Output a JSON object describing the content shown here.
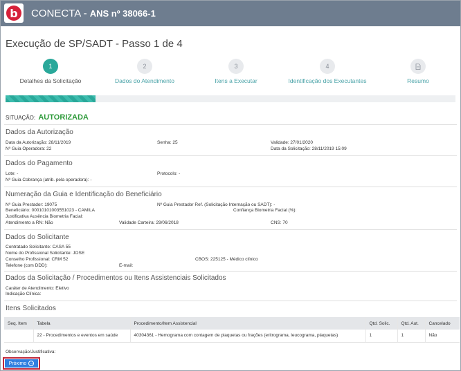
{
  "header": {
    "brand": "CONECTA",
    "ans": "ANS nº 38066-1",
    "logo_letter": "b"
  },
  "page_title": "Execução de SP/SADT - Passo 1 de 4",
  "steps": [
    {
      "num": "1",
      "label": "Detalhes da Solicitação",
      "icon": ""
    },
    {
      "num": "2",
      "label": "Dados do Atendimento",
      "icon": ""
    },
    {
      "num": "3",
      "label": "Itens a Executar",
      "icon": ""
    },
    {
      "num": "4",
      "label": "Identificação dos Executantes",
      "icon": ""
    },
    {
      "num": "",
      "label": "Resumo",
      "icon": "document-icon"
    }
  ],
  "progress": {
    "fraction": 0.2
  },
  "situacao": {
    "label": "SITUAÇÃO:",
    "value": "AUTORIZADA"
  },
  "sections": {
    "autorizacao": "Dados da Autorização",
    "pagamento": "Dados do Pagamento",
    "beneficiario": "Numeração da Guia e Identificação do Beneficiário",
    "solicitante": "Dados do Solicitante",
    "solicitacao": "Dados da Solicitação / Procedimentos ou Itens Assistenciais Solicitados",
    "itens": "Itens Solicitados"
  },
  "autorizacao": {
    "data_autorizacao": "Data da Autorização: 28/11/2019",
    "senha": "Senha: 25",
    "validade": "Validade: 27/01/2020",
    "guia_operadora": "Nº Guia Operadora: 22",
    "data_solicitacao": "Data da Solicitação: 28/11/2019 15:09"
  },
  "pagamento": {
    "lote": "Lote: -",
    "protocolo": "Protocolo: -",
    "guia_cobranca": "Nº Guia Cobrança (atrib. pela operadora): -"
  },
  "beneficiario": {
    "guia_prestador": "Nº Guia Prestador: 19075",
    "guia_prestador_ref": "Nº Guia Prestador Ref. (Solicitação Internação ou SADT): -",
    "beneficiario": "Beneficiário: 00010101003551023 - CAMILA",
    "confianca": "Confiança Biometria Facial (%):",
    "justificativa": "Justificativa Ausência Biometria Facial:",
    "atendimento_rn": "Atendimento a RN: Não",
    "validade_carteira": "Validade Carteira: 29/06/2018",
    "cns": "CNS: 70"
  },
  "solicitante": {
    "contratado": "Contratado Solicitante: CASA 55",
    "profissional": "Nome do Profissional Solicitante: JOSE",
    "conselho": "Conselho Profissional: CRM 52",
    "cbos": "CBOS: 225125 - Médico clínico",
    "telefone": "Telefone (com DDD):",
    "email": "E-mail:"
  },
  "solicitacao": {
    "carater": "Caráter de Atendimento: Eletivo",
    "indicacao": "Indicação Clínica:"
  },
  "table": {
    "headers": [
      "Seq. Item",
      "Tabela",
      "Procedimento/Item Assistencial",
      "Qtd. Solic.",
      "Qtd. Aut.",
      "Cancelado"
    ],
    "rows": [
      [
        "",
        "22 - Procedimentos e eventos em saúde",
        "40304361 - Hemograma com contagem de plaquetas ou frações (eritrograma, leucograma, plaquetas)",
        "1",
        "1",
        "Não"
      ]
    ]
  },
  "observacao": "Observação/Justificativa:",
  "next_button": "Próximo",
  "colors": {
    "topbar": "#6e7d8f",
    "accent": "#2aa89a",
    "status": "#2e9a3a",
    "button": "#2f7fe0",
    "logo": "#d6213a"
  }
}
